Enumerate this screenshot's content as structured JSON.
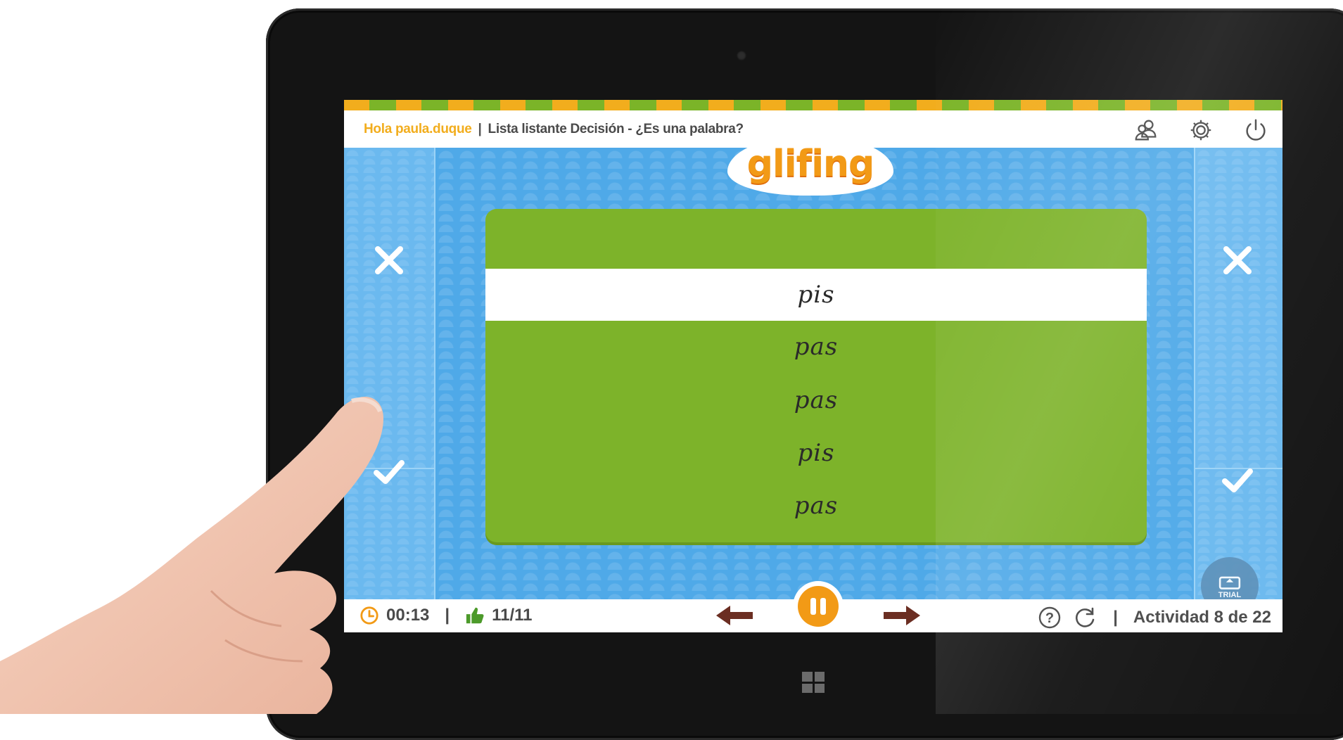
{
  "header": {
    "greeting": "Hola paula.duque",
    "separator": "|",
    "activity_title": "Lista listante Decisión - ¿Es una palabra?",
    "icons": [
      "users-icon",
      "gear-icon",
      "power-icon"
    ]
  },
  "logo": {
    "text": "glifing"
  },
  "words": {
    "items": [
      "pis",
      "pas",
      "pas",
      "pis",
      "pas"
    ],
    "selected_index": 0
  },
  "side_buttons": {
    "left": [
      "cross-icon",
      "check-icon"
    ],
    "right": [
      "cross-icon",
      "check-icon"
    ]
  },
  "footer": {
    "timer": "00:13",
    "pipe": "|",
    "score": "11/11",
    "activity_pipe": "|",
    "activity_counter": "Actividad 8 de 22"
  },
  "trial_badge": {
    "label": "TRIAL"
  },
  "colors": {
    "accent_orange": "#f29a16",
    "accent_green": "#7db32a",
    "background_blue": "#4fa9e8"
  }
}
